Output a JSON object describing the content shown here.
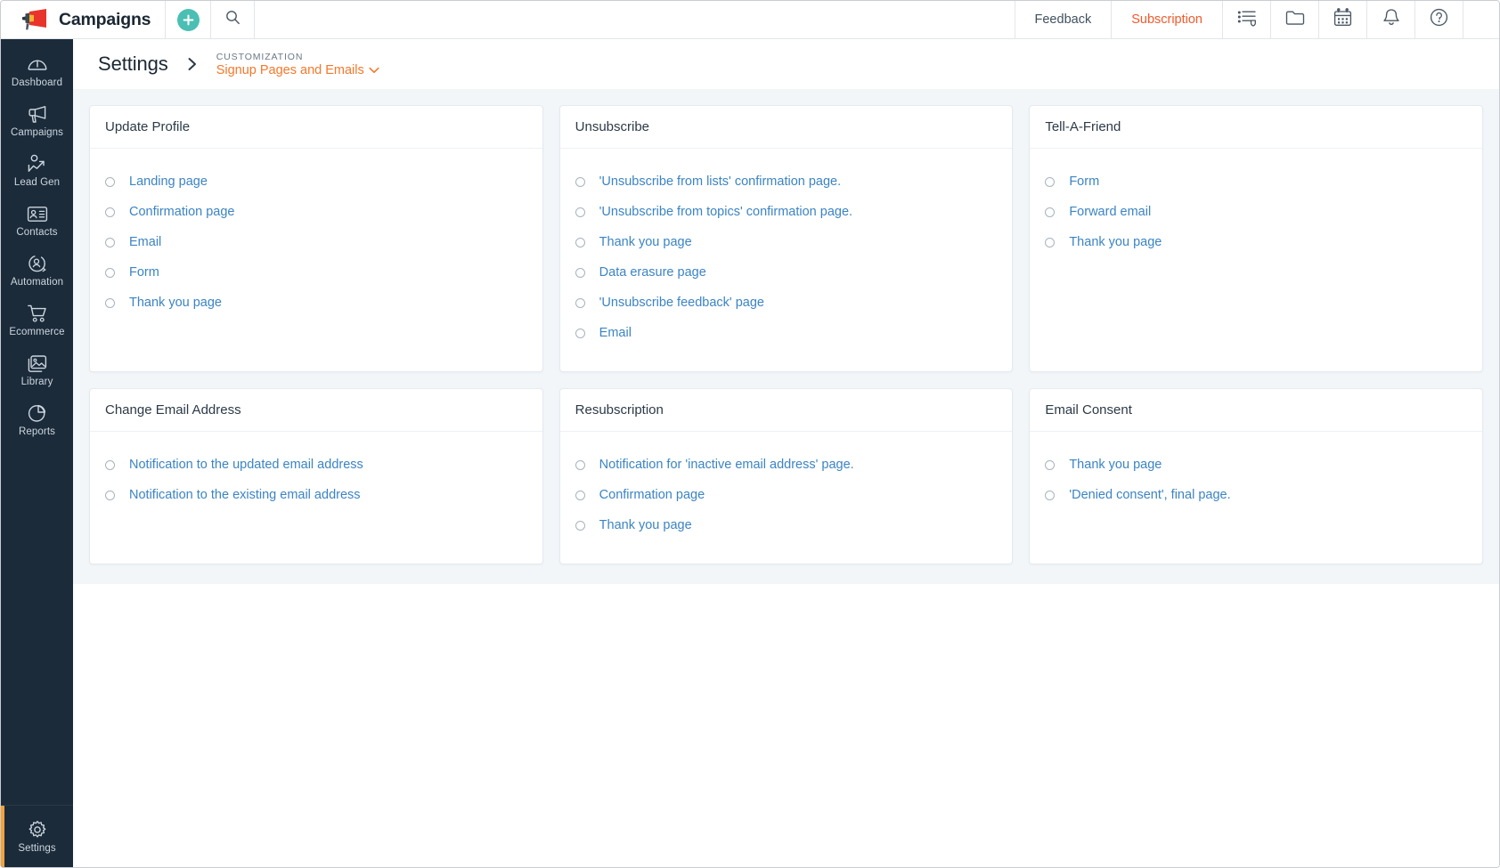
{
  "header": {
    "brand": "Campaigns",
    "logo_icon": "megaphone-logo-icon",
    "add_icon": "plus-icon",
    "search_icon": "search-icon",
    "feedback_label": "Feedback",
    "subscription_label": "Subscription",
    "icons": [
      {
        "name": "tasks-shield-icon"
      },
      {
        "name": "folder-icon"
      },
      {
        "name": "calendar-icon"
      },
      {
        "name": "bell-icon"
      },
      {
        "name": "help-circle-icon"
      }
    ],
    "accent_color": "#f4592a",
    "add_button_color": "#4bbfb4"
  },
  "sidebar": {
    "active_indicator_color": "#f2a33c",
    "background": "#1b2b3a",
    "items": [
      {
        "label": "Dashboard",
        "icon": "dashboard-gauge-icon"
      },
      {
        "label": "Campaigns",
        "icon": "megaphone-icon"
      },
      {
        "label": "Lead Gen",
        "icon": "lead-gen-icon"
      },
      {
        "label": "Contacts",
        "icon": "contact-card-icon"
      },
      {
        "label": "Automation",
        "icon": "automation-icon"
      },
      {
        "label": "Ecommerce",
        "icon": "shopping-cart-icon"
      },
      {
        "label": "Library",
        "icon": "library-images-icon"
      },
      {
        "label": "Reports",
        "icon": "pie-chart-icon"
      }
    ],
    "bottom_item": {
      "label": "Settings",
      "icon": "gear-icon",
      "active": true
    }
  },
  "breadcrumb": {
    "title": "Settings",
    "separator_icon": "chevron-right-icon",
    "kicker": "CUSTOMIZATION",
    "current": "Signup Pages and Emails",
    "current_caret_icon": "chevron-down-icon"
  },
  "cards": [
    {
      "title": "Update Profile",
      "options": [
        "Landing page",
        "Confirmation page",
        "Email",
        "Form",
        "Thank you page"
      ]
    },
    {
      "title": "Unsubscribe",
      "options": [
        "'Unsubscribe from lists' confirmation page.",
        "'Unsubscribe from topics' confirmation page.",
        "Thank you page",
        "Data erasure page",
        "'Unsubscribe feedback' page",
        "Email"
      ]
    },
    {
      "title": "Tell-A-Friend",
      "options": [
        "Form",
        "Forward email",
        "Thank you page"
      ]
    },
    {
      "title": "Change Email Address",
      "options": [
        "Notification to the updated email address",
        "Notification to the existing email address"
      ]
    },
    {
      "title": "Resubscription",
      "options": [
        "Notification for 'inactive email address' page.",
        "Confirmation page",
        "Thank you page"
      ]
    },
    {
      "title": "Email Consent",
      "options": [
        "Thank you page",
        "'Denied consent', final page."
      ]
    }
  ]
}
